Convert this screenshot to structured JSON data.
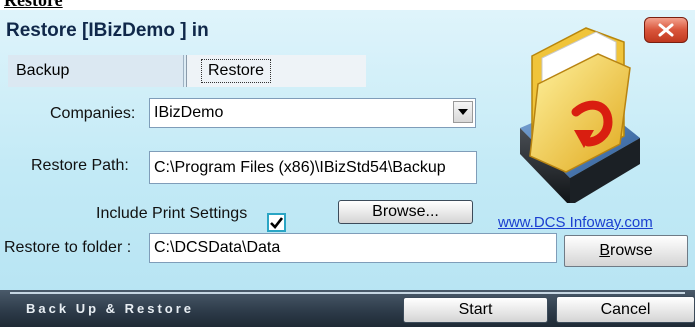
{
  "top_label": "Restore",
  "window": {
    "title": "Restore [IBizDemo ] in",
    "close_icon": "close-x-icon"
  },
  "tabs": [
    {
      "label": "Backup"
    },
    {
      "label": "Restore"
    }
  ],
  "companies": {
    "label": "Companies:",
    "value": "IBizDemo"
  },
  "restore_path": {
    "label": "Restore Path:",
    "value": "C:\\Program Files (x86)\\IBizStd54\\Backup"
  },
  "include_print": {
    "label": "Include Print Settings",
    "checked": true
  },
  "browse_top": {
    "label": "Browse..."
  },
  "link": {
    "text": "www.DCS Infoway.com"
  },
  "restore_folder": {
    "label": "Restore to folder :",
    "value": "C:\\DCSData\\Data"
  },
  "browse_bottom": {
    "label_first": "B",
    "label_rest": "rowse"
  },
  "bottom_bar": {
    "title": "Back Up & Restore"
  },
  "start_button": {
    "label": "Start"
  },
  "cancel_button": {
    "label": "Cancel"
  },
  "folder_icon": "folder-restore-icon"
}
